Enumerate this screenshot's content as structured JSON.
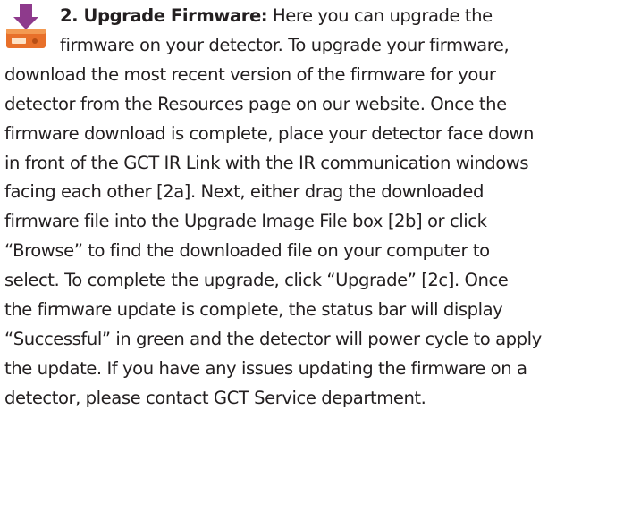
{
  "section": {
    "heading": "2. Upgrade Firmware:",
    "icon": "firmware-upgrade-icon",
    "lines": [
      " Here you can upgrade the",
      "firmware on your detector. To upgrade your firmware,",
      "download the most recent version of the firmware for your",
      "detector from the Resources page on our website. Once the",
      "firmware download is complete, place your detector face down",
      "in front of the GCT IR Link with the IR communication windows",
      "facing each other [2a]. Next, either drag the downloaded",
      "firmware file into the Upgrade Image File box [2b] or click",
      "“Browse” to find the downloaded file on your computer to",
      "select. To complete the upgrade, click “Upgrade” [2c]. Once",
      "the firmware update is complete, the status bar will display",
      "“Successful” in green and the detector will power cycle to apply",
      "the update. If you have any issues updating the firmware on a",
      "detector, please contact GCT Service department."
    ]
  },
  "colors": {
    "text": "#231f20",
    "icon_arrow": "#8e3a8c",
    "icon_device": "#e8702a"
  }
}
